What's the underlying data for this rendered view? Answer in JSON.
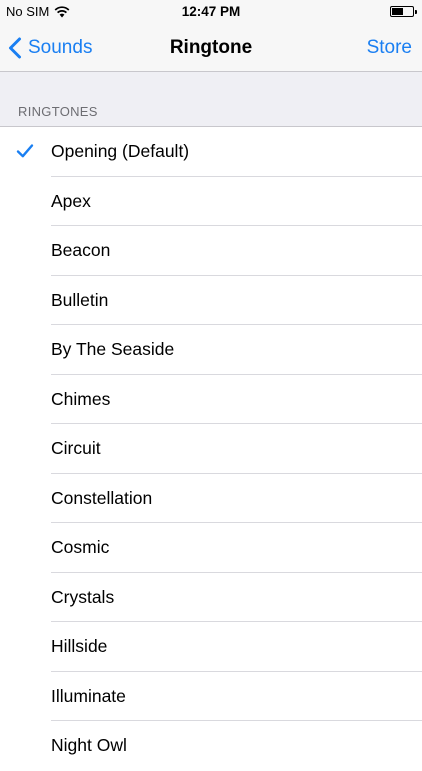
{
  "status_bar": {
    "carrier": "No SIM",
    "time": "12:47 PM"
  },
  "nav": {
    "back_label": "Sounds",
    "title": "Ringtone",
    "right_label": "Store"
  },
  "section": {
    "header": "RINGTONES"
  },
  "ringtones": [
    {
      "label": "Opening (Default)",
      "selected": true
    },
    {
      "label": "Apex",
      "selected": false
    },
    {
      "label": "Beacon",
      "selected": false
    },
    {
      "label": "Bulletin",
      "selected": false
    },
    {
      "label": "By The Seaside",
      "selected": false
    },
    {
      "label": "Chimes",
      "selected": false
    },
    {
      "label": "Circuit",
      "selected": false
    },
    {
      "label": "Constellation",
      "selected": false
    },
    {
      "label": "Cosmic",
      "selected": false
    },
    {
      "label": "Crystals",
      "selected": false
    },
    {
      "label": "Hillside",
      "selected": false
    },
    {
      "label": "Illuminate",
      "selected": false
    },
    {
      "label": "Night Owl",
      "selected": false
    }
  ],
  "colors": {
    "accent": "#1a7ff2",
    "section_background": "#efeff4",
    "separator": "#d9d9de"
  },
  "icons": {
    "back": "chevron-left-icon",
    "selected": "checkmark-icon",
    "wifi": "wifi-icon",
    "battery": "battery-icon"
  }
}
